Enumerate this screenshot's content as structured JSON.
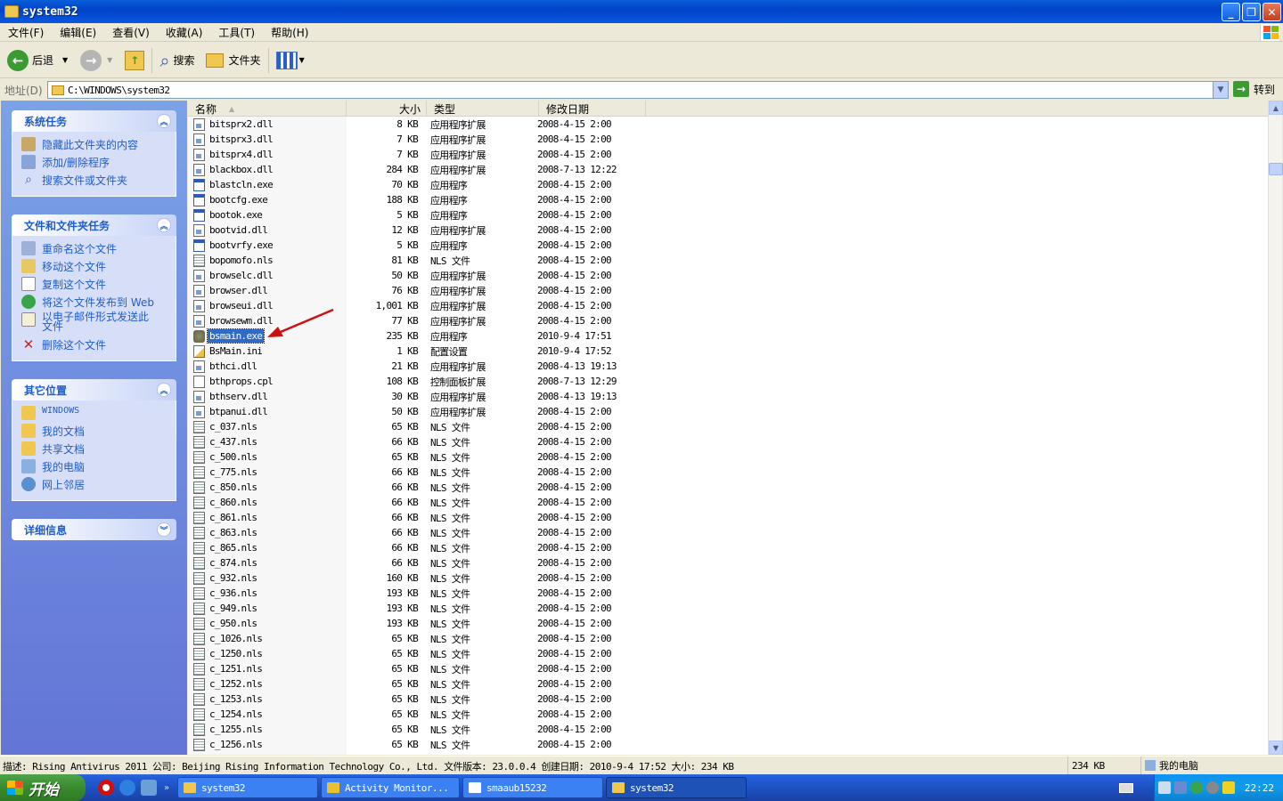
{
  "window": {
    "title": "system32"
  },
  "menu": [
    "文件(F)",
    "编辑(E)",
    "查看(V)",
    "收藏(A)",
    "工具(T)",
    "帮助(H)"
  ],
  "toolbar": {
    "back": "后退",
    "search": "搜索",
    "folders": "文件夹"
  },
  "address": {
    "label": "地址(D)",
    "value": "C:\\WINDOWS\\system32",
    "go": "转到"
  },
  "tasks": {
    "system": {
      "title": "系统任务",
      "items": [
        "隐藏此文件夹的内容",
        "添加/删除程序",
        "搜索文件或文件夹"
      ]
    },
    "file": {
      "title": "文件和文件夹任务",
      "items": [
        "重命名这个文件",
        "移动这个文件",
        "复制这个文件",
        "将这个文件发布到 Web",
        "以电子邮件形式发送此文件",
        "删除这个文件"
      ]
    },
    "other": {
      "title": "其它位置",
      "items": [
        "WINDOWS",
        "我的文档",
        "共享文档",
        "我的电脑",
        "网上邻居"
      ]
    },
    "details": {
      "title": "详细信息"
    }
  },
  "columns": {
    "name": "名称",
    "size": "大小",
    "type": "类型",
    "date": "修改日期"
  },
  "files": [
    {
      "name": "bitsprx2.dll",
      "size": "8 KB",
      "type": "应用程序扩展",
      "date": "2008-4-15 2:00",
      "icon": "dll"
    },
    {
      "name": "bitsprx3.dll",
      "size": "7 KB",
      "type": "应用程序扩展",
      "date": "2008-4-15 2:00",
      "icon": "dll"
    },
    {
      "name": "bitsprx4.dll",
      "size": "7 KB",
      "type": "应用程序扩展",
      "date": "2008-4-15 2:00",
      "icon": "dll"
    },
    {
      "name": "blackbox.dll",
      "size": "284 KB",
      "type": "应用程序扩展",
      "date": "2008-7-13 12:22",
      "icon": "dll"
    },
    {
      "name": "blastcln.exe",
      "size": "70 KB",
      "type": "应用程序",
      "date": "2008-4-15 2:00",
      "icon": "exe"
    },
    {
      "name": "bootcfg.exe",
      "size": "188 KB",
      "type": "应用程序",
      "date": "2008-4-15 2:00",
      "icon": "exe"
    },
    {
      "name": "bootok.exe",
      "size": "5 KB",
      "type": "应用程序",
      "date": "2008-4-15 2:00",
      "icon": "exe"
    },
    {
      "name": "bootvid.dll",
      "size": "12 KB",
      "type": "应用程序扩展",
      "date": "2008-4-15 2:00",
      "icon": "dll"
    },
    {
      "name": "bootvrfy.exe",
      "size": "5 KB",
      "type": "应用程序",
      "date": "2008-4-15 2:00",
      "icon": "exe"
    },
    {
      "name": "bopomofo.nls",
      "size": "81 KB",
      "type": "NLS 文件",
      "date": "2008-4-15 2:00",
      "icon": "nls"
    },
    {
      "name": "browselc.dll",
      "size": "50 KB",
      "type": "应用程序扩展",
      "date": "2008-4-15 2:00",
      "icon": "dll"
    },
    {
      "name": "browser.dll",
      "size": "76 KB",
      "type": "应用程序扩展",
      "date": "2008-4-15 2:00",
      "icon": "dll"
    },
    {
      "name": "browseui.dll",
      "size": "1,001 KB",
      "type": "应用程序扩展",
      "date": "2008-4-15 2:00",
      "icon": "dll"
    },
    {
      "name": "browsewm.dll",
      "size": "77 KB",
      "type": "应用程序扩展",
      "date": "2008-4-15 2:00",
      "icon": "dll"
    },
    {
      "name": "bsmain.exe",
      "size": "235 KB",
      "type": "应用程序",
      "date": "2010-9-4 17:51",
      "icon": "bsm",
      "selected": true
    },
    {
      "name": "BsMain.ini",
      "size": "1 KB",
      "type": "配置设置",
      "date": "2010-9-4 17:52",
      "icon": "ini"
    },
    {
      "name": "bthci.dll",
      "size": "21 KB",
      "type": "应用程序扩展",
      "date": "2008-4-13 19:13",
      "icon": "dll"
    },
    {
      "name": "bthprops.cpl",
      "size": "108 KB",
      "type": "控制面板扩展",
      "date": "2008-7-13 12:29",
      "icon": "cpl"
    },
    {
      "name": "bthserv.dll",
      "size": "30 KB",
      "type": "应用程序扩展",
      "date": "2008-4-13 19:13",
      "icon": "dll"
    },
    {
      "name": "btpanui.dll",
      "size": "50 KB",
      "type": "应用程序扩展",
      "date": "2008-4-15 2:00",
      "icon": "dll"
    },
    {
      "name": "c_037.nls",
      "size": "65 KB",
      "type": "NLS 文件",
      "date": "2008-4-15 2:00",
      "icon": "nls"
    },
    {
      "name": "c_437.nls",
      "size": "66 KB",
      "type": "NLS 文件",
      "date": "2008-4-15 2:00",
      "icon": "nls"
    },
    {
      "name": "c_500.nls",
      "size": "65 KB",
      "type": "NLS 文件",
      "date": "2008-4-15 2:00",
      "icon": "nls"
    },
    {
      "name": "c_775.nls",
      "size": "66 KB",
      "type": "NLS 文件",
      "date": "2008-4-15 2:00",
      "icon": "nls"
    },
    {
      "name": "c_850.nls",
      "size": "66 KB",
      "type": "NLS 文件",
      "date": "2008-4-15 2:00",
      "icon": "nls"
    },
    {
      "name": "c_860.nls",
      "size": "66 KB",
      "type": "NLS 文件",
      "date": "2008-4-15 2:00",
      "icon": "nls"
    },
    {
      "name": "c_861.nls",
      "size": "66 KB",
      "type": "NLS 文件",
      "date": "2008-4-15 2:00",
      "icon": "nls"
    },
    {
      "name": "c_863.nls",
      "size": "66 KB",
      "type": "NLS 文件",
      "date": "2008-4-15 2:00",
      "icon": "nls"
    },
    {
      "name": "c_865.nls",
      "size": "66 KB",
      "type": "NLS 文件",
      "date": "2008-4-15 2:00",
      "icon": "nls"
    },
    {
      "name": "c_874.nls",
      "size": "66 KB",
      "type": "NLS 文件",
      "date": "2008-4-15 2:00",
      "icon": "nls"
    },
    {
      "name": "c_932.nls",
      "size": "160 KB",
      "type": "NLS 文件",
      "date": "2008-4-15 2:00",
      "icon": "nls"
    },
    {
      "name": "c_936.nls",
      "size": "193 KB",
      "type": "NLS 文件",
      "date": "2008-4-15 2:00",
      "icon": "nls"
    },
    {
      "name": "c_949.nls",
      "size": "193 KB",
      "type": "NLS 文件",
      "date": "2008-4-15 2:00",
      "icon": "nls"
    },
    {
      "name": "c_950.nls",
      "size": "193 KB",
      "type": "NLS 文件",
      "date": "2008-4-15 2:00",
      "icon": "nls"
    },
    {
      "name": "c_1026.nls",
      "size": "65 KB",
      "type": "NLS 文件",
      "date": "2008-4-15 2:00",
      "icon": "nls"
    },
    {
      "name": "c_1250.nls",
      "size": "65 KB",
      "type": "NLS 文件",
      "date": "2008-4-15 2:00",
      "icon": "nls"
    },
    {
      "name": "c_1251.nls",
      "size": "65 KB",
      "type": "NLS 文件",
      "date": "2008-4-15 2:00",
      "icon": "nls"
    },
    {
      "name": "c_1252.nls",
      "size": "65 KB",
      "type": "NLS 文件",
      "date": "2008-4-15 2:00",
      "icon": "nls"
    },
    {
      "name": "c_1253.nls",
      "size": "65 KB",
      "type": "NLS 文件",
      "date": "2008-4-15 2:00",
      "icon": "nls"
    },
    {
      "name": "c_1254.nls",
      "size": "65 KB",
      "type": "NLS 文件",
      "date": "2008-4-15 2:00",
      "icon": "nls"
    },
    {
      "name": "c_1255.nls",
      "size": "65 KB",
      "type": "NLS 文件",
      "date": "2008-4-15 2:00",
      "icon": "nls"
    },
    {
      "name": "c_1256.nls",
      "size": "65 KB",
      "type": "NLS 文件",
      "date": "2008-4-15 2:00",
      "icon": "nls"
    }
  ],
  "status": {
    "description": "描述: Rising Antivirus 2011 公司: Beijing Rising Information Technology Co., Ltd. 文件版本: 23.0.0.4 创建日期: 2010-9-4 17:52 大小: 234 KB",
    "size": "234 KB",
    "location": "我的电脑"
  },
  "taskbar": {
    "start": "开始",
    "tasks": [
      "system32",
      "Activity Monitor...",
      "smaaub15232",
      "system32"
    ],
    "clock": "22:22"
  },
  "colors": {
    "selection": "#316ac5",
    "link": "#215dc6",
    "titlebar": "#0a5fd8",
    "annotation_arrow": "#d01010"
  }
}
